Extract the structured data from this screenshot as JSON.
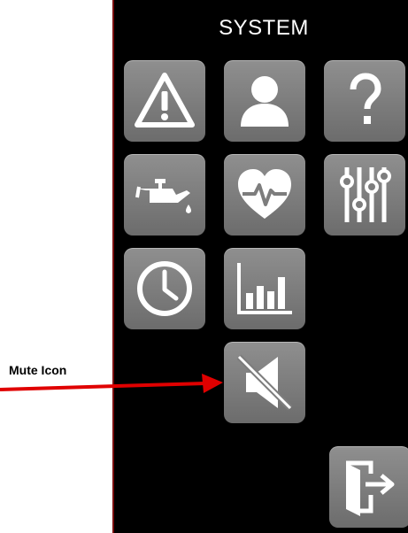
{
  "panel": {
    "title": "SYSTEM"
  },
  "tiles": [
    {
      "name": "warning",
      "icon": "warning-triangle-icon"
    },
    {
      "name": "user",
      "icon": "user-icon"
    },
    {
      "name": "help",
      "icon": "question-mark-icon"
    },
    {
      "name": "oil",
      "icon": "oil-can-icon"
    },
    {
      "name": "health",
      "icon": "heart-pulse-icon"
    },
    {
      "name": "settings",
      "icon": "sliders-icon"
    },
    {
      "name": "clock",
      "icon": "clock-icon"
    },
    {
      "name": "stats",
      "icon": "bar-chart-icon"
    },
    {
      "name": "mute",
      "icon": "mute-speaker-icon"
    },
    {
      "name": "exit",
      "icon": "exit-door-icon"
    }
  ],
  "annotation": {
    "label": "Mute Icon",
    "color": "#e00000"
  },
  "colors": {
    "panel_bg": "#000000",
    "tile_bg": "#7d7d7d",
    "icon": "#ffffff"
  }
}
